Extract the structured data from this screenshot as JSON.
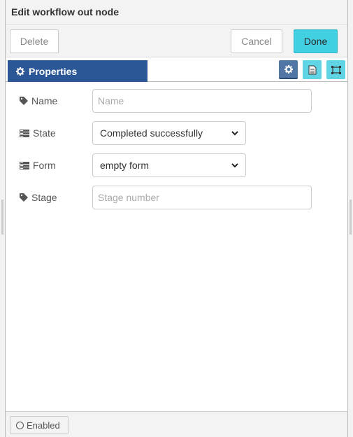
{
  "header": {
    "title": "Edit workflow out node"
  },
  "toolbar": {
    "delete_label": "Delete",
    "cancel_label": "Cancel",
    "done_label": "Done"
  },
  "tabs": {
    "properties_label": "Properties",
    "icons": [
      "gear-icon",
      "description-icon",
      "appearance-icon"
    ]
  },
  "form": {
    "name": {
      "label": "Name",
      "placeholder": "Name",
      "value": "",
      "icon": "tag-icon"
    },
    "state": {
      "label": "State",
      "selected": "Completed successfully",
      "icon": "list-icon"
    },
    "form_field": {
      "label": "Form",
      "selected": "empty form",
      "icon": "list-icon"
    },
    "stage": {
      "label": "Stage",
      "placeholder": "Stage number",
      "value": "",
      "icon": "tag-icon"
    }
  },
  "footer": {
    "enabled_label": "Enabled"
  },
  "colors": {
    "accent": "#2b5797",
    "done": "#41d0e1"
  }
}
